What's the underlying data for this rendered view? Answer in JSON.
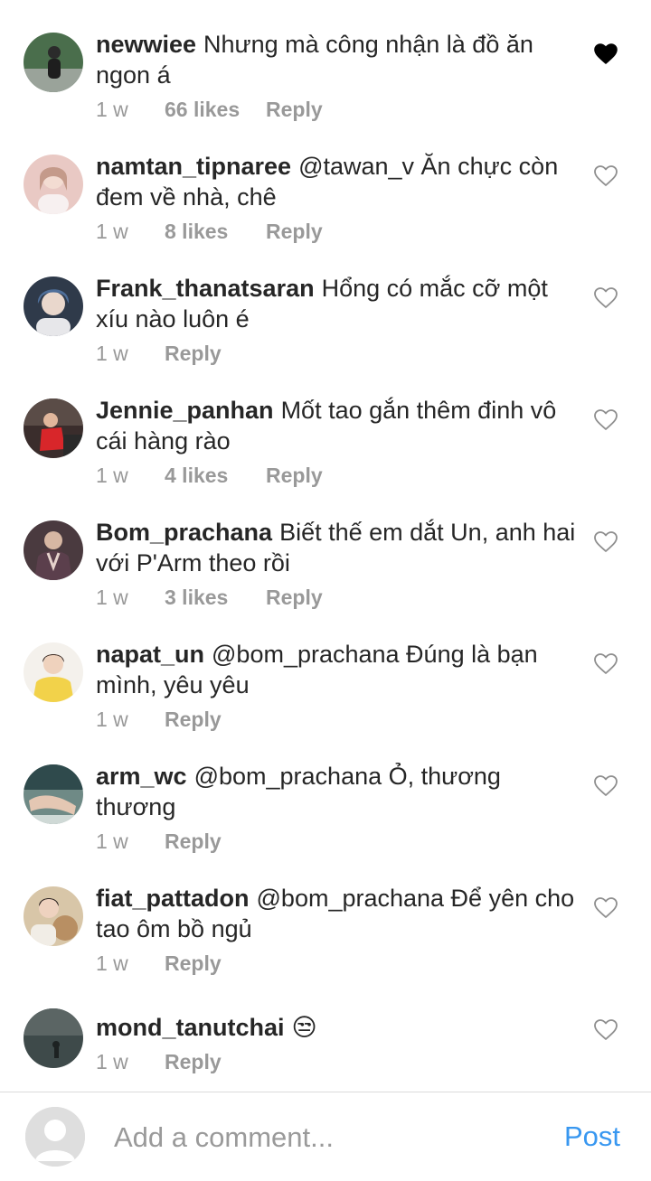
{
  "comments": [
    {
      "username": "newwiee",
      "text": "Nhưng mà công nhận là đồ ăn ngon á",
      "time": "1 w",
      "likes": "66 likes",
      "reply": "Reply",
      "liked": true,
      "avatar_color": "#4a6e4c",
      "avatar_icon": "avatar-outdoor-photo"
    },
    {
      "username": "namtan_tipnaree",
      "text": "@tawan_v Ăn chực còn đem về nhà, chê",
      "time": "1 w",
      "likes": "8 likes",
      "reply": "Reply",
      "liked": false,
      "avatar_color": "#e9c9c4",
      "avatar_icon": "avatar-portrait-photo"
    },
    {
      "username": "Frank_thanatsaran",
      "text": "Hổng có mắc cỡ một xíu nào luôn é",
      "time": "1 w",
      "likes": "",
      "reply": "Reply",
      "liked": false,
      "avatar_color": "#2f3a4a",
      "avatar_icon": "avatar-portrait-photo"
    },
    {
      "username": "Jennie_panhan",
      "text": "Mốt tao gắn thêm đinh vô cái hàng rào",
      "time": "1 w",
      "likes": "4 likes",
      "reply": "Reply",
      "liked": false,
      "avatar_color": "#3a2d2c",
      "avatar_icon": "avatar-red-outfit-photo"
    },
    {
      "username": "Bom_prachana",
      "text": "Biết thế em dắt Un, anh hai với P'Arm theo rồi",
      "time": "1 w",
      "likes": "3 likes",
      "reply": "Reply",
      "liked": false,
      "avatar_color": "#4a3a3f",
      "avatar_icon": "avatar-portrait-photo"
    },
    {
      "username": "napat_un",
      "text": "@bom_prachana Đúng là bạn mình, yêu yêu",
      "time": "1 w",
      "likes": "",
      "reply": "Reply",
      "liked": false,
      "avatar_color": "#f2d24a",
      "avatar_icon": "avatar-portrait-photo"
    },
    {
      "username": "arm_wc",
      "text": "@bom_prachana Ỏ, thương thương",
      "time": "1 w",
      "likes": "",
      "reply": "Reply",
      "liked": false,
      "avatar_color": "#6f8a86",
      "avatar_icon": "avatar-pool-photo"
    },
    {
      "username": "fiat_pattadon",
      "text": "@bom_prachana Để yên cho tao ôm bồ ngủ",
      "time": "1 w",
      "likes": "",
      "reply": "Reply",
      "liked": false,
      "avatar_color": "#d8c6a8",
      "avatar_icon": "avatar-portrait-photo"
    },
    {
      "username": "mond_tanutchai",
      "text": "😒",
      "time": "1 w",
      "likes": "",
      "reply": "Reply",
      "liked": false,
      "avatar_color": "#3e4a4a",
      "avatar_icon": "avatar-dark-scene-photo"
    }
  ],
  "composer": {
    "placeholder": "Add a comment...",
    "post_label": "Post",
    "avatar_icon": "default-user-icon"
  },
  "colors": {
    "liked_heart": "#000000",
    "unliked_heart": "#8e8e8e",
    "link_blue": "#3897f0",
    "meta_gray": "#999999"
  }
}
